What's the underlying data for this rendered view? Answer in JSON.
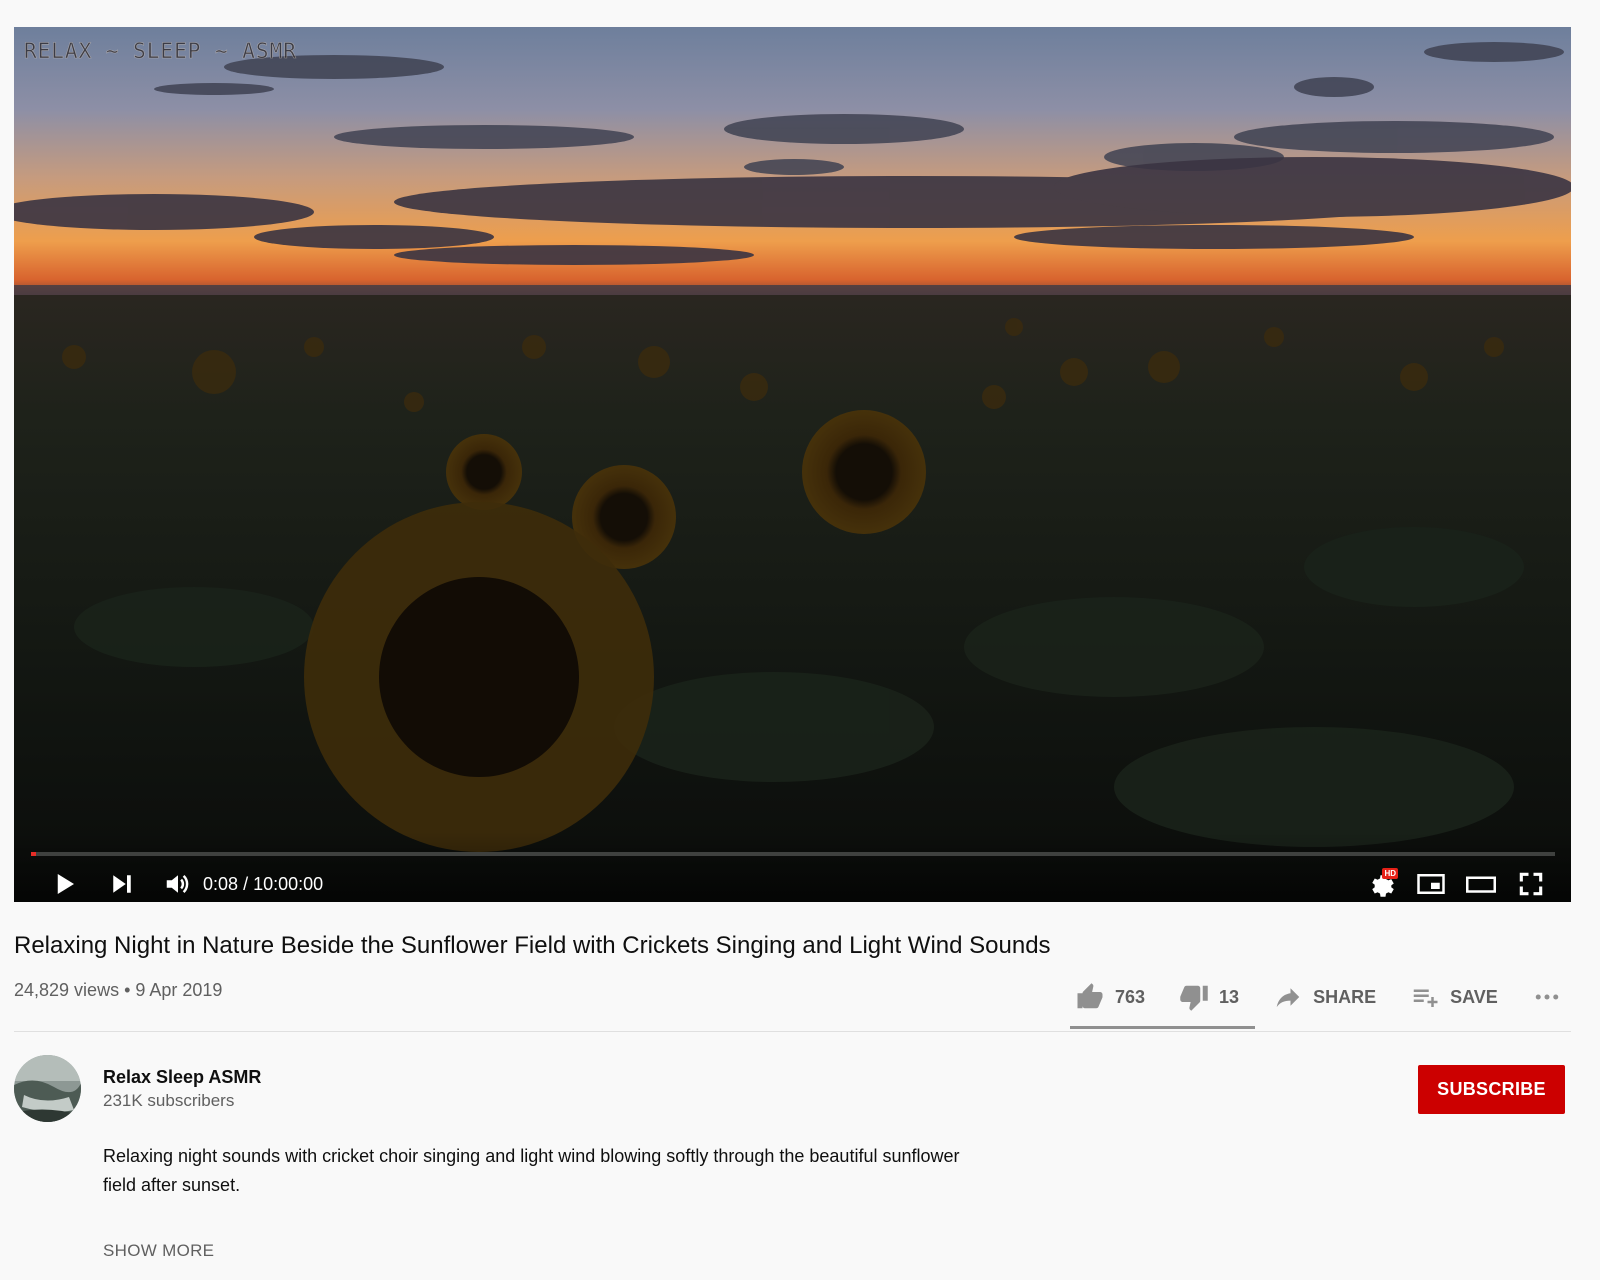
{
  "player": {
    "watermark": "RELAX ~ SLEEP ~ ASMR",
    "current_time": "0:08",
    "duration": "10:00:00",
    "time_display": "0:08 / 10:00:00",
    "progress_fraction": 0.0002,
    "hd_badge": "HD",
    "played_color": "#e52d27",
    "controls": {
      "play_icon": "play-icon",
      "next_icon": "skip-next-icon",
      "volume_icon": "volume-icon",
      "settings_icon": "settings-gear-icon",
      "miniplayer_icon": "miniplayer-icon",
      "theater_icon": "theater-mode-icon",
      "fullscreen_icon": "fullscreen-icon"
    }
  },
  "video": {
    "title": "Relaxing Night in Nature Beside the Sunflower Field with Crickets Singing and Light Wind Sounds",
    "meta": "24,829 views • 9 Apr 2019"
  },
  "actions": {
    "likes": "763",
    "dislikes": "13",
    "share_label": "SHARE",
    "save_label": "SAVE",
    "more_icon": "more-horizontal-icon"
  },
  "channel": {
    "name": "Relax Sleep ASMR",
    "subscribers": "231K subscribers",
    "subscribe_label": "SUBSCRIBE",
    "subscribe_color": "#cc0000"
  },
  "description": {
    "text": "Relaxing night sounds with cricket choir singing and light wind blowing softly through the beautiful sunflower field after sunset.",
    "show_more_label": "SHOW MORE"
  }
}
